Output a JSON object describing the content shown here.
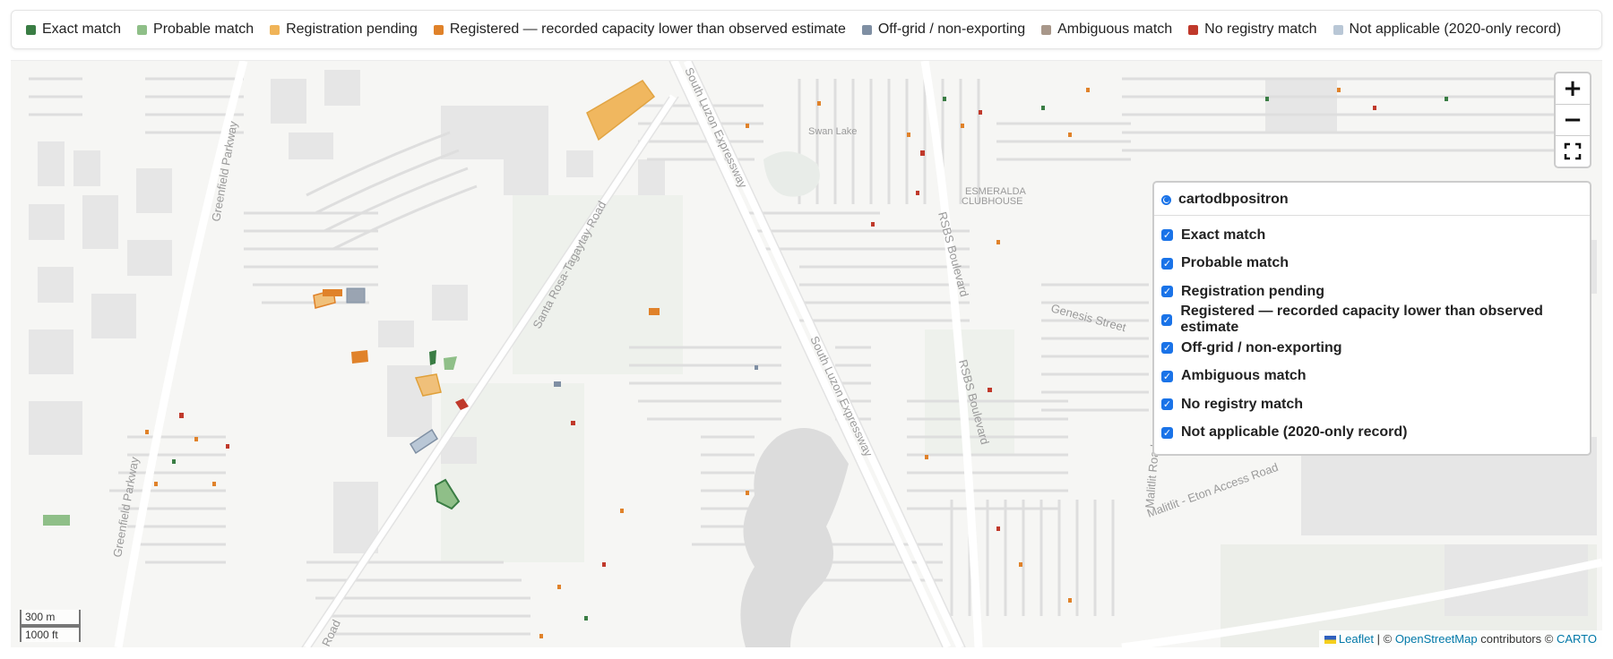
{
  "legend": {
    "items": [
      {
        "label": "Exact match",
        "color": "#3a7d44"
      },
      {
        "label": "Probable match",
        "color": "#8fbf88"
      },
      {
        "label": "Registration pending",
        "color": "#f0b458"
      },
      {
        "label": "Registered — recorded capacity lower than observed estimate",
        "color": "#e0822a"
      },
      {
        "label": "Off-grid / non-exporting",
        "color": "#7f8fa3"
      },
      {
        "label": "Ambiguous match",
        "color": "#a8978a"
      },
      {
        "label": "No registry match",
        "color": "#c0392b"
      },
      {
        "label": "Not applicable (2020-only record)",
        "color": "#b9c7d6"
      }
    ]
  },
  "map": {
    "zoom_in": "+",
    "zoom_out": "−",
    "fullscreen_icon": "fullscreen-icon",
    "road_labels": [
      "Greenfield Parkway",
      "South Luzon Expressway",
      "Santa Rosa-Tagaytay Road",
      "South Luzon Expressway",
      "RSBS Boulevard",
      "RSBS Boulevard",
      "Genesis Street",
      "Greenfield Parkway",
      "Malitlit Road",
      "Malitlit - Eton Access Road",
      "Road"
    ],
    "place_labels": [
      "Swan Lake",
      "ESMERALDA",
      "CLUBHOUSE"
    ]
  },
  "layers": {
    "base": "cartodbpositron",
    "overlays": [
      "Exact match",
      "Probable match",
      "Registration pending",
      "Registered — recorded capacity lower than observed estimate",
      "Off-grid / non-exporting",
      "Ambiguous match",
      "No registry match",
      "Not applicable (2020-only record)"
    ]
  },
  "scale": {
    "metric": "300 m",
    "imperial": "1000 ft"
  },
  "attribution": {
    "leaflet": "Leaflet",
    "sep": "|",
    "copy1": "©",
    "osm": "OpenStreetMap",
    "contributors": "contributors ©",
    "carto": "CARTO"
  }
}
